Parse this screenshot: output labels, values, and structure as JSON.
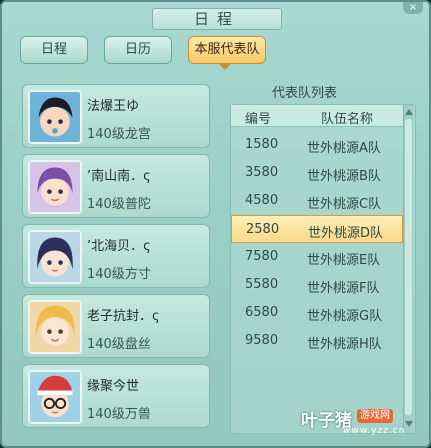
{
  "window": {
    "title": "日程",
    "close_label": "×"
  },
  "tabs": [
    {
      "label": "日程",
      "active": false
    },
    {
      "label": "日历",
      "active": false
    },
    {
      "label": "本服代表队",
      "active": true
    }
  ],
  "members": [
    {
      "name": "法爆王ゆ",
      "level": "140级龙宫"
    },
    {
      "name": "’南山南．ς",
      "level": "140级普陀"
    },
    {
      "name": "’北海贝．ς",
      "level": "140级方寸"
    },
    {
      "name": "老子抗封．ς",
      "level": "140级盘丝"
    },
    {
      "name": "缘聚今世",
      "level": "140级万兽"
    }
  ],
  "team_panel": {
    "title": "代表队列表",
    "columns": [
      "编号",
      "队伍名称"
    ],
    "rows": [
      {
        "id": "1580",
        "name": "世外桃源A队",
        "selected": false
      },
      {
        "id": "3580",
        "name": "世外桃源B队",
        "selected": false
      },
      {
        "id": "4580",
        "name": "世外桃源C队",
        "selected": false
      },
      {
        "id": "2580",
        "name": "世外桃源D队",
        "selected": true
      },
      {
        "id": "7580",
        "name": "世外桃源E队",
        "selected": false
      },
      {
        "id": "5580",
        "name": "世外桃源F队",
        "selected": false
      },
      {
        "id": "6580",
        "name": "世外桃源G队",
        "selected": false
      },
      {
        "id": "9580",
        "name": "世外桃源H队",
        "selected": false
      }
    ]
  },
  "watermark": {
    "main": "叶子猪",
    "tag": "游戏网",
    "url": "www.yzz.cn"
  },
  "colors": {
    "accent": "#f3c867",
    "panel": "#a9d9d0",
    "selected_row": "#f7d98a"
  }
}
